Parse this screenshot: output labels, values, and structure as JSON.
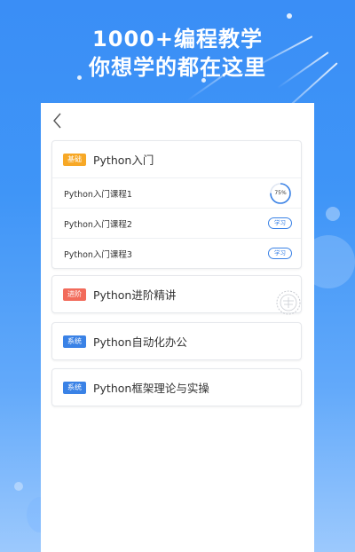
{
  "header": {
    "line1": "1000+编程教学",
    "line2": "你想学的都在这里"
  },
  "colors": {
    "accent_blue": "#3a82e6",
    "tag_basic": "#f7a826",
    "tag_advanced": "#f26b5b",
    "tag_system": "#3a82e6"
  },
  "nav": {
    "back_icon": "chevron-left-icon"
  },
  "courses": [
    {
      "tag": "基础",
      "title": "Python入门",
      "lessons": [
        {
          "name": "Python入门课程1",
          "progress_label": "75%",
          "progress": 0.75
        },
        {
          "name": "Python入门课程2",
          "action": "学习"
        },
        {
          "name": "Python入门课程3",
          "action": "学习"
        }
      ]
    },
    {
      "tag": "进阶",
      "title": "Python进阶精讲",
      "stamp_icon": "seal-stamp-icon"
    },
    {
      "tag": "系统",
      "title": "Python自动化办公"
    },
    {
      "tag": "系统",
      "title": "Python框架理论与实操"
    }
  ]
}
